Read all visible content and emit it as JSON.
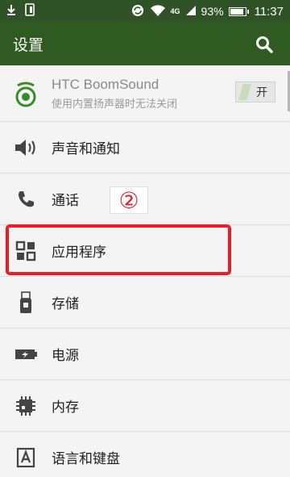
{
  "status_bar": {
    "signal": "4G",
    "battery": "93%",
    "battery_level": 0.93,
    "time": "11:37"
  },
  "app_bar": {
    "title": "设置"
  },
  "items": [
    {
      "title": "HTC BoomSound",
      "subtitle": "使用内置扬声器时无法关闭",
      "toggle_label": "开",
      "icon": "boomsound-icon"
    },
    {
      "label": "声音和通知",
      "icon": "speaker-icon"
    },
    {
      "label": "通话",
      "icon": "phone-icon"
    },
    {
      "label": "应用程序",
      "icon": "apps-grid-icon"
    },
    {
      "label": "存储",
      "icon": "usb-storage-icon"
    },
    {
      "label": "电源",
      "icon": "battery-icon"
    },
    {
      "label": "内存",
      "icon": "memory-chip-icon"
    },
    {
      "label": "语言和键盘",
      "icon": "keyboard-a-icon"
    }
  ],
  "annotation": {
    "step_marker": "②",
    "highlight_color": "#ee1c24"
  },
  "colors": {
    "status_bar": "#2f5226",
    "app_bar": "#2f5a22",
    "accent_green": "#3a8a2a"
  }
}
